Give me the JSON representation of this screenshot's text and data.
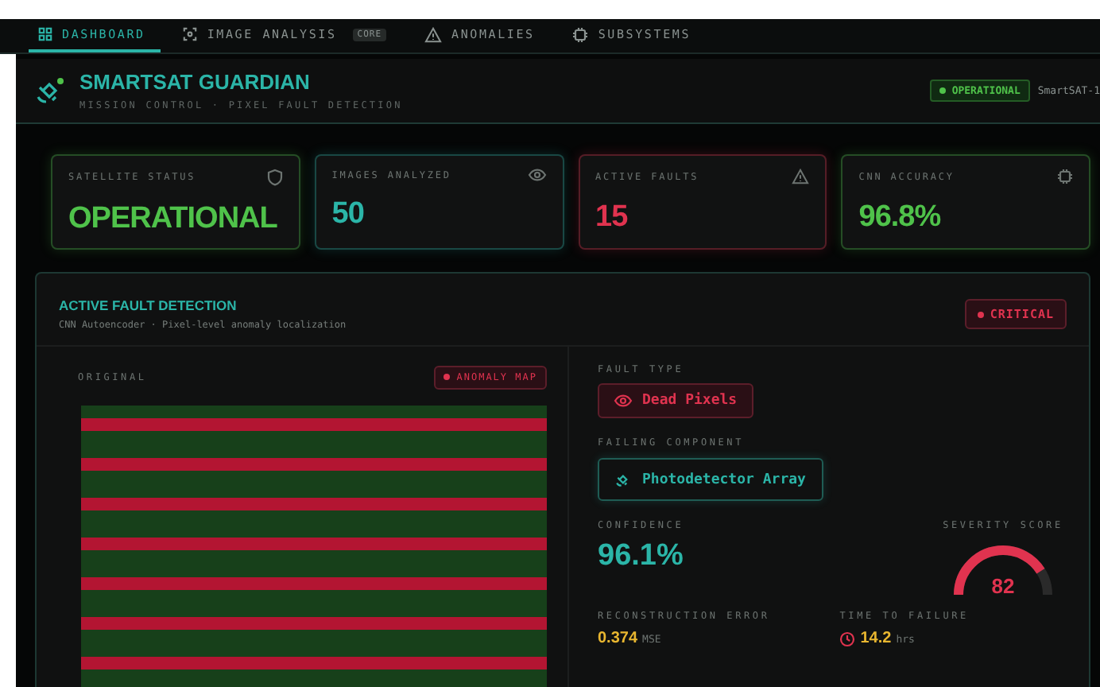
{
  "tabs": [
    {
      "label": "DASHBOARD",
      "selected": true
    },
    {
      "label": "IMAGE ANALYSIS",
      "badge": "CORE",
      "selected": false
    },
    {
      "label": "ANOMALIES",
      "selected": false
    },
    {
      "label": "SUBSYSTEMS",
      "selected": false
    }
  ],
  "header": {
    "title": "SMARTSAT GUARDIAN",
    "subtitle": "MISSION CONTROL · PIXEL FAULT DETECTION",
    "status": "OPERATIONAL",
    "satellite": "SmartSAT-1"
  },
  "stats": [
    {
      "label": "SATELLITE STATUS",
      "value": "OPERATIONAL",
      "color": "#4fc24a"
    },
    {
      "label": "IMAGES ANALYZED",
      "value": "50",
      "color": "#2bb5a8"
    },
    {
      "label": "ACTIVE FAULTS",
      "value": "15",
      "color": "#e0334f"
    },
    {
      "label": "CNN ACCURACY",
      "value": "96.8%",
      "color": "#4fc24a"
    }
  ],
  "detection": {
    "title": "ACTIVE FAULT DETECTION",
    "subtitle": "CNN Autoencoder · Pixel-level anomaly localization",
    "severity_badge": "CRITICAL",
    "image_label": "ORIGINAL",
    "map_badge": "ANOMALY MAP",
    "fault_type_label": "FAULT TYPE",
    "fault_type": "Dead Pixels",
    "component_label": "FAILING COMPONENT",
    "component": "Photodetector Array",
    "confidence_label": "CONFIDENCE",
    "confidence": "96.1%",
    "severity_label": "SEVERITY SCORE",
    "severity": "82",
    "error_label": "RECONSTRUCTION ERROR",
    "error": "0.374",
    "error_unit": "MSE",
    "ttf_label": "TIME TO FAILURE",
    "ttf": "14.2",
    "ttf_unit": "hrs"
  }
}
